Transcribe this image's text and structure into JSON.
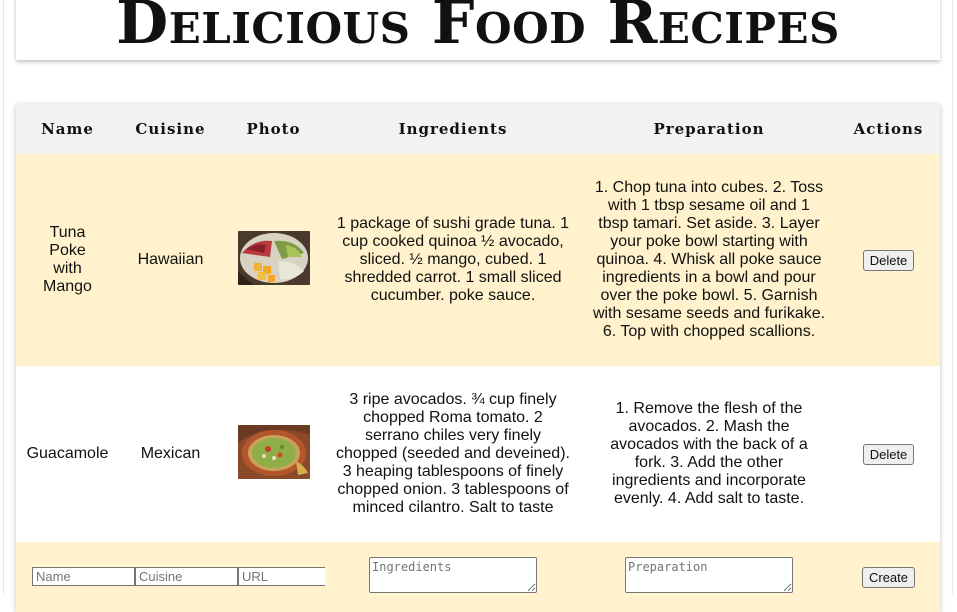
{
  "title": "Delicious Food Recipes",
  "columns": [
    "Name",
    "Cuisine",
    "Photo",
    "Ingredients",
    "Preparation",
    "Actions"
  ],
  "recipes": [
    {
      "name": "Tuna Poke with Mango",
      "cuisine": "Hawaiian",
      "photo": "poke-bowl-photo",
      "ingredients": "1 package of sushi grade tuna. 1 cup cooked quinoa ½ avocado, sliced. ½ mango, cubed. 1 shredded carrot. 1 small sliced cucumber. poke sauce.",
      "preparation": "1. Chop tuna into cubes. 2. Toss with 1 tbsp sesame oil and 1 tbsp tamari. Set aside. 3. Layer your poke bowl starting with quinoa. 4. Whisk all poke sauce ingredients in a bowl and pour over the poke bowl. 5. Garnish with sesame seeds and furikake. 6. Top with chopped scallions.",
      "action": "Delete"
    },
    {
      "name": "Guacamole",
      "cuisine": "Mexican",
      "photo": "guacamole-photo",
      "ingredients": "3 ripe avocados. ¾ cup finely chopped Roma tomato. 2 serrano chiles very finely chopped (seeded and deveined). 3 heaping tablespoons of finely chopped onion. 3 tablespoons of minced cilantro. Salt to taste",
      "preparation": "1. Remove the flesh of the avocados. 2. Mash the avocados with the back of a fork. 3. Add the other ingredients and incorporate evenly. 4. Add salt to taste.",
      "action": "Delete"
    }
  ],
  "form": {
    "name_placeholder": "Name",
    "cuisine_placeholder": "Cuisine",
    "url_placeholder": "URL",
    "ingredients_placeholder": "Ingredients",
    "preparation_placeholder": "Preparation",
    "create_label": "Create"
  },
  "colors": {
    "row_highlight": "#fff2cc",
    "header_bg": "#f2f2f2"
  }
}
